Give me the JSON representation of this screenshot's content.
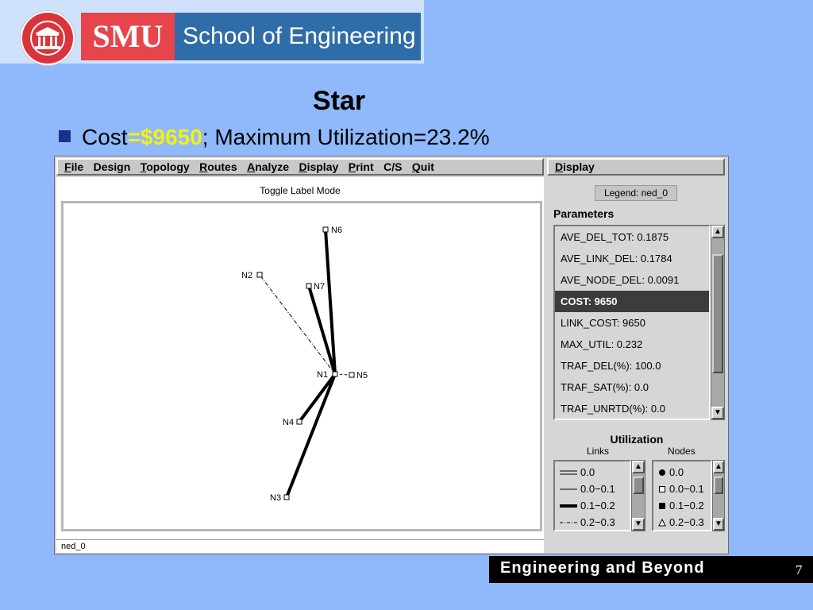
{
  "branding": {
    "logo_text": "SMU",
    "school_text": "School of Engineering",
    "footer_text": "Engineering and Beyond",
    "page_number": "7"
  },
  "slide": {
    "title": "Star",
    "cost_label": "Cost",
    "cost_value": "=$9650",
    "rest": "; Maximum Utilization=23.2%"
  },
  "menu": {
    "items": [
      {
        "first": "F",
        "rest": "ile"
      },
      {
        "first": "",
        "rest": "Design"
      },
      {
        "first": "T",
        "rest": "opology"
      },
      {
        "first": "R",
        "rest": "outes"
      },
      {
        "first": "A",
        "rest": "nalyze"
      },
      {
        "first": "D",
        "rest": "isplay"
      },
      {
        "first": "P",
        "rest": "rint"
      },
      {
        "first": "",
        "rest": "C/S"
      },
      {
        "first": "Q",
        "rest": "uit"
      }
    ],
    "right_first": "D",
    "right_rest": "isplay"
  },
  "canvas": {
    "toggle_label": "Toggle Label Mode",
    "status": "ned_0",
    "nodes": [
      "N6",
      "N2",
      "N7",
      "N1",
      "N5",
      "N4",
      "N3"
    ]
  },
  "side": {
    "legend": "Legend: ned_0",
    "params_title": "Parameters",
    "params": [
      "AVE_DEL_TOT: 0.1875",
      "AVE_LINK_DEL: 0.1784",
      "AVE_NODE_DEL: 0.0091",
      "COST: 9650",
      "LINK_COST: 9650",
      "MAX_UTIL: 0.232",
      "TRAF_DEL(%): 100.0",
      "TRAF_SAT(%): 0.0",
      "TRAF_UNRTD(%): 0.0"
    ],
    "selected_param": 3,
    "util_title": "Utilization",
    "links_label": "Links",
    "nodes_label": "Nodes",
    "links": [
      "0.0",
      "0.0−0.1",
      "0.1−0.2",
      "0.2−0.3"
    ],
    "node_levels": [
      "0.0",
      "0.0−0.1",
      "0.1−0.2",
      "0.2−0.3"
    ]
  }
}
